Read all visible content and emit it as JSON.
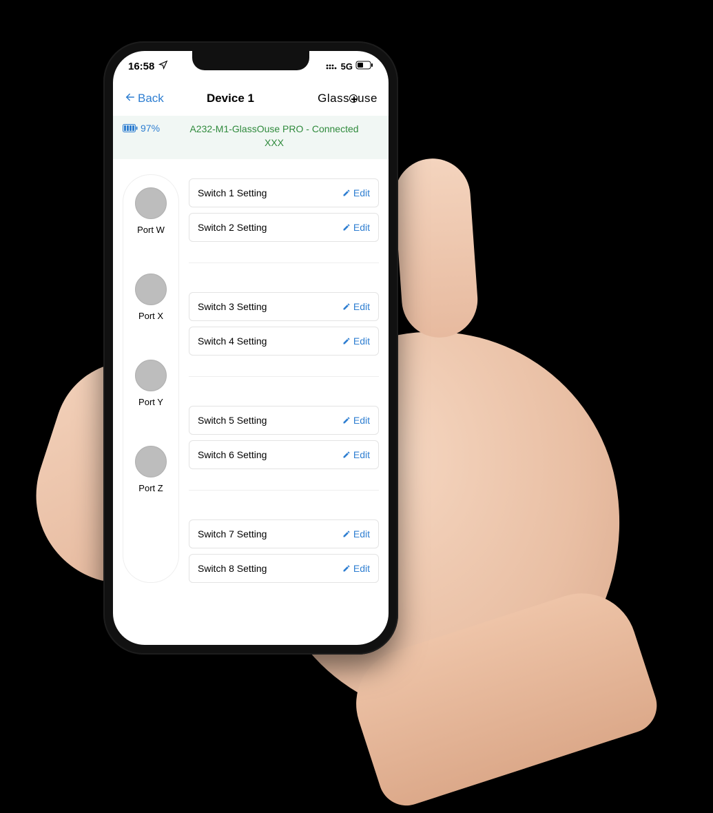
{
  "status": {
    "time": "16:58",
    "network_label": "5G"
  },
  "nav": {
    "back_label": "Back",
    "title": "Device 1",
    "brand_left": "Glass",
    "brand_right": "use"
  },
  "banner": {
    "battery_pct": "97%",
    "conn_line1": "A232-M1-GlassOuse PRO  - Connected",
    "conn_line2": "XXX"
  },
  "edit_label": "Edit",
  "ports": [
    {
      "name": "Port W",
      "switches": [
        "Switch 1 Setting",
        "Switch 2 Setting"
      ]
    },
    {
      "name": "Port X",
      "switches": [
        "Switch 3 Setting",
        "Switch 4 Setting"
      ]
    },
    {
      "name": "Port Y",
      "switches": [
        "Switch 5 Setting",
        "Switch 6 Setting"
      ]
    },
    {
      "name": "Port Z",
      "switches": [
        "Switch 7 Setting",
        "Switch 8 Setting"
      ]
    }
  ]
}
